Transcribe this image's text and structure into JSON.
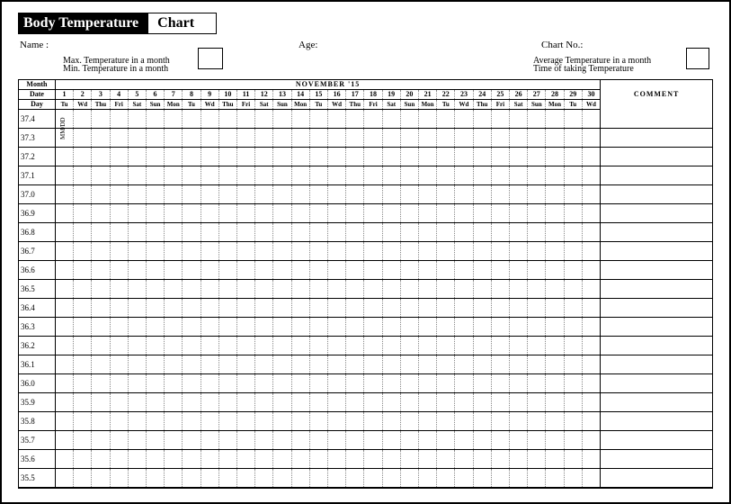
{
  "title": {
    "left": "Body Temperature",
    "right": "Chart"
  },
  "meta": {
    "name_label": "Name :",
    "age_label": "Age:",
    "chartno_label": "Chart No.:",
    "max_label": "Max. Temperature in a month",
    "min_label": "Min. Temperature in a month",
    "avg_label": "Average Temperature in a month",
    "time_label": "Time of taking Temperature"
  },
  "header": {
    "month_lbl": "Month",
    "date_lbl": "Date",
    "day_lbl": "Day",
    "month_name": "NOVEMBER '15",
    "comment_lbl": "COMMENT",
    "mm_dd": "MM/DD"
  },
  "dates": [
    "1",
    "2",
    "3",
    "4",
    "5",
    "6",
    "7",
    "8",
    "9",
    "10",
    "11",
    "12",
    "13",
    "14",
    "15",
    "16",
    "17",
    "18",
    "19",
    "20",
    "21",
    "22",
    "23",
    "24",
    "25",
    "26",
    "27",
    "28",
    "29",
    "30"
  ],
  "dows": [
    "Tu",
    "Wd",
    "Thu",
    "Fri",
    "Sat",
    "Sun",
    "Mon",
    "Tu",
    "Wd",
    "Thu",
    "Fri",
    "Sat",
    "Sun",
    "Mon",
    "Tu",
    "Wd",
    "Thu",
    "Fri",
    "Sat",
    "Sun",
    "Mon",
    "Tu",
    "Wd",
    "Thu",
    "Fri",
    "Sat",
    "Sun",
    "Mon",
    "Tu",
    "Wd"
  ],
  "rows": [
    "37.4",
    "37.3",
    "37.2",
    "37.1",
    "37.0",
    "36.9",
    "36.8",
    "36.7",
    "36.6",
    "36.5",
    "36.4",
    "36.3",
    "36.2",
    "36.1",
    "36.0",
    "35.9",
    "35.8",
    "35.7",
    "35.6",
    "35.5"
  ],
  "chart_data": {
    "type": "table",
    "title": "Body Temperature Chart",
    "xlabel": "Date",
    "ylabel": "Temperature",
    "x": [
      "1",
      "2",
      "3",
      "4",
      "5",
      "6",
      "7",
      "8",
      "9",
      "10",
      "11",
      "12",
      "13",
      "14",
      "15",
      "16",
      "17",
      "18",
      "19",
      "20",
      "21",
      "22",
      "23",
      "24",
      "25",
      "26",
      "27",
      "28",
      "29",
      "30"
    ],
    "y_levels": [
      37.4,
      37.3,
      37.2,
      37.1,
      37.0,
      36.9,
      36.8,
      36.7,
      36.6,
      36.5,
      36.4,
      36.3,
      36.2,
      36.1,
      36.0,
      35.9,
      35.8,
      35.7,
      35.6,
      35.5
    ],
    "series": [],
    "month": "NOVEMBER '15"
  }
}
